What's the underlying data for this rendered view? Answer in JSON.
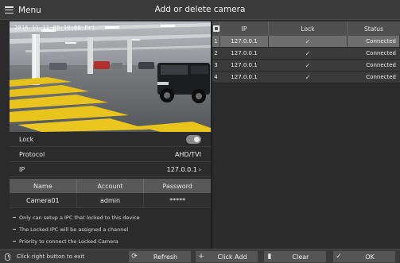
{
  "header": {
    "menu_label": "Menu",
    "title": "Add or delete camera"
  },
  "preview": {
    "timestamp": "2016.11.11  08:10:00  Fri"
  },
  "settings": {
    "lock_label": "Lock",
    "protocol_label": "Protocol",
    "protocol_value": "AHD/TVI",
    "ip_label": "IP",
    "ip_value": "127.0.0.1"
  },
  "account": {
    "headers": [
      "Name",
      "Account",
      "Password"
    ],
    "row": [
      "Camera01",
      "admin",
      "*****"
    ]
  },
  "notes": [
    "Only can setup a IPC that locked to this device",
    "The Locked IPC will be assigned a channel",
    "Priority to connect the Locked Camera"
  ],
  "camera_table": {
    "headers": [
      "IP",
      "Lock",
      "Status"
    ],
    "rows": [
      {
        "index": "1",
        "ip": "127.0.0.1",
        "lock": "✓",
        "status": "Connected"
      },
      {
        "index": "2",
        "ip": "127.0.0.1",
        "lock": "✓",
        "status": "Connected"
      },
      {
        "index": "3",
        "ip": "127.0.0.1",
        "lock": "✓",
        "status": "Connected"
      },
      {
        "index": "4",
        "ip": "127.0.0.1",
        "lock": "✓",
        "status": "Connected"
      }
    ]
  },
  "footer": {
    "exit_hint": "Click right button to exit",
    "refresh_label": "Refresh",
    "click_add_label": "Click Add",
    "clear_label": "Clear",
    "ok_label": "OK"
  },
  "icons": {
    "menu": "hamburger-icon",
    "mouse": "mouse-icon",
    "refresh": "refresh-icon",
    "add": "plus-icon",
    "clear": "trash-icon",
    "ok": "check-icon",
    "toggle": "toggle-icon"
  },
  "colors": {
    "background": "#2b2b2b",
    "selected_row": "#6e6e6e",
    "header_row": "#505050"
  }
}
